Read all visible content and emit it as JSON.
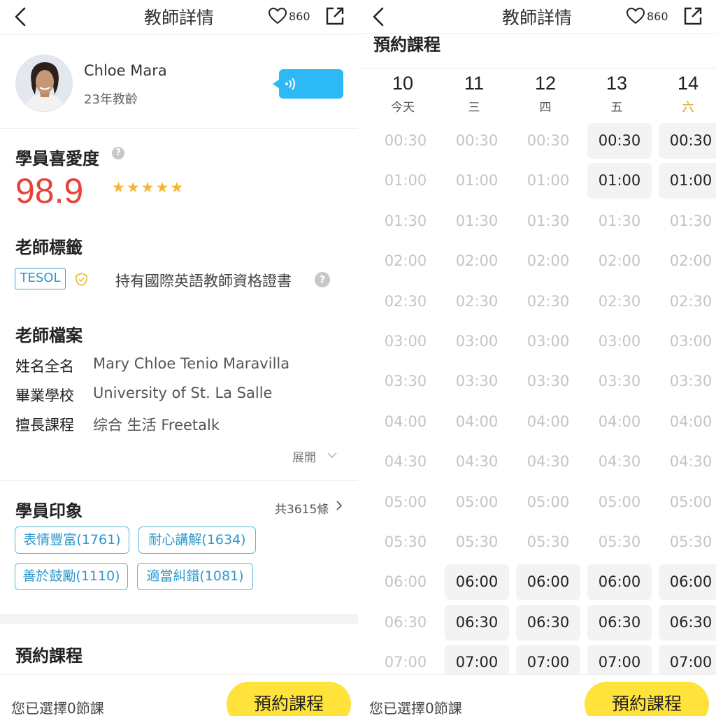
{
  "header": {
    "title": "教師詳情",
    "favorites": "860"
  },
  "teacher": {
    "name": "Chloe Mara",
    "experience": "23年教齡"
  },
  "popularity": {
    "heading": "學員喜愛度",
    "score": "98.9",
    "stars": 5
  },
  "tags": {
    "heading": "老師標籤",
    "badge": "TESOL",
    "certificate": "持有國際英語教師資格證書"
  },
  "profile": {
    "heading": "老師檔案",
    "rows": [
      {
        "label": "姓名全名",
        "value": "Mary Chloe Tenio Maravilla"
      },
      {
        "label": "畢業學校",
        "value": "University of St. La Salle"
      },
      {
        "label": "擅長課程",
        "value": "综合 生活 Freetalk"
      }
    ],
    "expand_label": "展開"
  },
  "impressions": {
    "heading": "學員印象",
    "total": "共3615條",
    "chips": [
      "表情豐富(1761)",
      "耐心講解(1634)",
      "善於鼓勵(1110)",
      "適當糾錯(1081)"
    ]
  },
  "booking": {
    "heading": "預約課程"
  },
  "footer": {
    "selected_text": "您已選擇0節課",
    "book_button": "預約課程"
  },
  "schedule": {
    "title": "預約課程",
    "days": [
      {
        "date": "10",
        "label": "今天"
      },
      {
        "date": "11",
        "label": "三"
      },
      {
        "date": "12",
        "label": "四"
      },
      {
        "date": "13",
        "label": "五"
      },
      {
        "date": "14",
        "label": "六"
      }
    ],
    "times": [
      "00:30",
      "01:00",
      "01:30",
      "02:00",
      "02:30",
      "03:00",
      "03:30",
      "04:00",
      "04:30",
      "05:00",
      "05:30",
      "06:00",
      "06:30",
      "07:00"
    ],
    "available": [
      [
        false,
        false,
        false,
        false,
        false,
        false,
        false,
        false,
        false,
        false,
        false,
        false,
        false,
        false
      ],
      [
        false,
        false,
        false,
        false,
        false,
        false,
        false,
        false,
        false,
        false,
        false,
        true,
        true,
        true
      ],
      [
        false,
        false,
        false,
        false,
        false,
        false,
        false,
        false,
        false,
        false,
        false,
        true,
        true,
        true
      ],
      [
        true,
        true,
        false,
        false,
        false,
        false,
        false,
        false,
        false,
        false,
        false,
        true,
        true,
        true
      ],
      [
        true,
        true,
        false,
        false,
        false,
        false,
        false,
        false,
        false,
        false,
        false,
        true,
        true,
        true
      ]
    ]
  },
  "colors": {
    "accent_blue": "#2cb9f5",
    "score_red": "#e8413a",
    "star": "#f5b531",
    "cta_yellow": "#ffe33a",
    "saturday": "#d6a300"
  }
}
